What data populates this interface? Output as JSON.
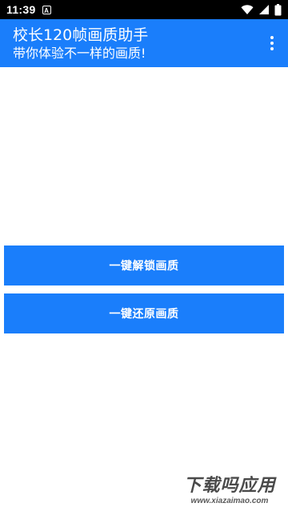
{
  "status_bar": {
    "time": "11:39",
    "notification_icon": "A"
  },
  "app_bar": {
    "title": "校长120帧画质助手",
    "subtitle": "带你体验不一样的画质!"
  },
  "buttons": {
    "unlock_label": "一键解锁画质",
    "restore_label": "一键还原画质"
  },
  "watermark": {
    "brand": "下载吗应用",
    "url": "www.xiazaimao.com"
  },
  "colors": {
    "accent": "#1a7efb",
    "status_bar": "#000000",
    "background": "#ffffff"
  }
}
